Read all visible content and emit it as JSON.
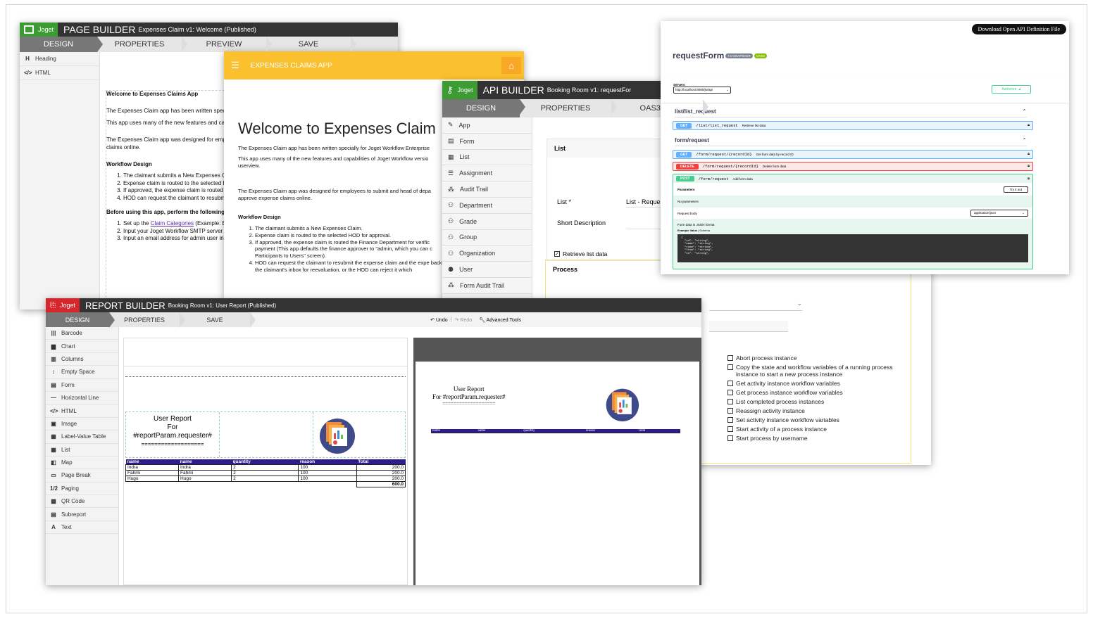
{
  "page_builder": {
    "logo_text": "Joget",
    "title": "PAGE BUILDER",
    "subtitle": "Expenses Claim v1: Welcome (Published)",
    "tabs": [
      "DESIGN",
      "PROPERTIES",
      "PREVIEW",
      "SAVE"
    ],
    "sidebar": [
      {
        "icon": "H",
        "label": "Heading"
      },
      {
        "icon": "</>",
        "label": "HTML"
      }
    ],
    "content": {
      "heading": "Welcome to Expenses Claims App",
      "p1": "The Expenses Claim app has been written spec",
      "p2": "This app uses many of the new features and ca",
      "p3": "The Expenses Claim app was designed for emp",
      "p3b": "claims online.",
      "workflow_heading": "Workflow Design",
      "workflow_items": [
        "The claimant submits a New Expenses C",
        "Expense claim is routed to the selected H",
        "If approved, the expense claim is routed (This app defaults the finance approver t screen).",
        "HOD can request the claimant to resubm claimant's inbox for reevaluation, or the H"
      ],
      "before_heading": "Before using this app, perform the following",
      "before_items": [
        {
          "prefix": "Set up the ",
          "link": "Claim Categories",
          "suffix": " (Example: E"
        },
        {
          "prefix": "Input your Joget Workflow SMTP server messages.",
          "link": "",
          "suffix": ""
        },
        {
          "prefix": "Input an email address for admin user in",
          "link": "",
          "suffix": ""
        }
      ]
    }
  },
  "expenses_app": {
    "header_title": "EXPENSES CLAIMS APP",
    "heading": "Welcome to Expenses Claim",
    "p1": "The Expenses Claim app has been written specially for Joget Workflow Enterprise",
    "p2": "This app uses many of the new features and capabilities of Joget Workflow versio",
    "p2b": "userview.",
    "p3": "The Expenses Claim app was designed for employees to submit and head of depa",
    "p3b": "approve expense claims online.",
    "workflow_heading": "Workflow Design",
    "workflow_items": [
      "The claimant submits a New Expenses Claim.",
      "Expense claim is routed to the selected HOD for approval.",
      "If approved, the expense claim is routed the Finance Department for verific payment (This app defaults the finance approver to \"admin, which you can c Participants to Users\" screen).",
      "HOD can request the claimant to resubmit the expense claim and the expe back to the claimant's inbox for reevaluation, or the HOD can reject it which"
    ]
  },
  "api_builder": {
    "logo_text": "Joget",
    "title": "API BUILDER",
    "subtitle": "Booking Room v1: requestFor",
    "tabs": [
      "DESIGN",
      "PROPERTIES",
      "OAS3 DO"
    ],
    "sidebar": [
      "App",
      "Form",
      "List",
      "Assignment",
      "Audit Trail",
      "Department",
      "Grade",
      "Group",
      "Organization",
      "User",
      "Form Audit Trail"
    ],
    "panel_title": "List",
    "list_label": "List *",
    "list_value": "List - Reque",
    "short_desc_label": "Short Description",
    "retrieve_label": "Retrieve list data",
    "process_title": "Process",
    "checkboxes": [
      "Abort process instance",
      "Copy the state and workflow variables of a running process instance to start a new process instance",
      "Get activity instance workflow variables",
      "Get process instance workflow variables",
      "List completed process instances",
      "Reassign activity instance",
      "Set activity instance workflow variables",
      "Start activity of a process instance",
      "Start process by username"
    ]
  },
  "swagger": {
    "download_label": "Download Open API Definition File",
    "title": "requestForm",
    "version_badge": "7.0-SNAPSHOT",
    "oas_badge": "OAS3",
    "servers_label": "Servers",
    "server_value": "http://localhost:8080/jw/api",
    "authorize_label": "Authorize",
    "group1": "list/list_request",
    "group2": "form/request",
    "endpoints": [
      {
        "method": "GET",
        "path": "/list/list_request",
        "desc": "Retrieve list data",
        "color": "#61affe",
        "bg": "#ebf3fb"
      },
      {
        "method": "GET",
        "path": "/form/request/{recordId}",
        "desc": "Get form data by record ID",
        "color": "#61affe",
        "bg": "#ebf3fb"
      },
      {
        "method": "DELETE",
        "path": "/form/request/{recordId}",
        "desc": "Delete form data",
        "color": "#f93e3e",
        "bg": "#fbe7e7"
      },
      {
        "method": "POST",
        "path": "/form/request",
        "desc": "Add form data",
        "color": "#49cc90",
        "bg": "#e8f6f0"
      }
    ],
    "parameters_label": "Parameters",
    "try_label": "Try it out",
    "no_params": "No parameters",
    "request_body": "Request body",
    "content_type": "application/json",
    "form_desc": "Form data in JSON format",
    "example_label": "Example Value",
    "schema_label": "Schema",
    "code_lines": [
      "{",
      "  \"id\": \"string\",",
      "  \"name\": \"string\",",
      "  \"room\": \"string\",",
      "  \"from\": \"string\",",
      "  \"to\": \"string\","
    ]
  },
  "report_builder": {
    "logo_text": "Joget",
    "title": "REPORT BUILDER",
    "subtitle": "Booking Room v1: User Report (Published)",
    "tabs": [
      "DESIGN",
      "PROPERTIES",
      "SAVE"
    ],
    "undo": "Undo",
    "redo": "Redo",
    "advanced": "Advanced Tools",
    "sidebar": [
      {
        "icon": "|||",
        "label": "Barcode"
      },
      {
        "icon": "▆",
        "label": "Chart"
      },
      {
        "icon": "▥",
        "label": "Columns"
      },
      {
        "icon": "↕",
        "label": "Empty Space"
      },
      {
        "icon": "▤",
        "label": "Form"
      },
      {
        "icon": "—",
        "label": "Horizontal Line"
      },
      {
        "icon": "</>",
        "label": "HTML"
      },
      {
        "icon": "▣",
        "label": "Image"
      },
      {
        "icon": "▦",
        "label": "Label-Value Table"
      },
      {
        "icon": "▦",
        "label": "List"
      },
      {
        "icon": "◧",
        "label": "Map"
      },
      {
        "icon": "▭",
        "label": "Page Break"
      },
      {
        "icon": "1/2",
        "label": "Paging"
      },
      {
        "icon": "▩",
        "label": "QR Code"
      },
      {
        "icon": "▤",
        "label": "Subreport"
      },
      {
        "icon": "A",
        "label": "Text"
      }
    ],
    "report_title": "User Report",
    "report_for": "For",
    "report_param": "#reportParam.requester#",
    "report_underline": "===================",
    "preview_for": "For #reportParam.requester#",
    "table_headers": [
      "name",
      "name",
      "quantity",
      "reason",
      "Total"
    ],
    "table_rows": [
      [
        "Indra",
        "Indra",
        "2",
        "100",
        "200.0"
      ],
      [
        "Fahmi",
        "Fahmi",
        "2",
        "100",
        "200.0"
      ],
      [
        "Hugo",
        "Hugo",
        "2",
        "100",
        "200.0"
      ]
    ],
    "table_total": "600.0"
  }
}
